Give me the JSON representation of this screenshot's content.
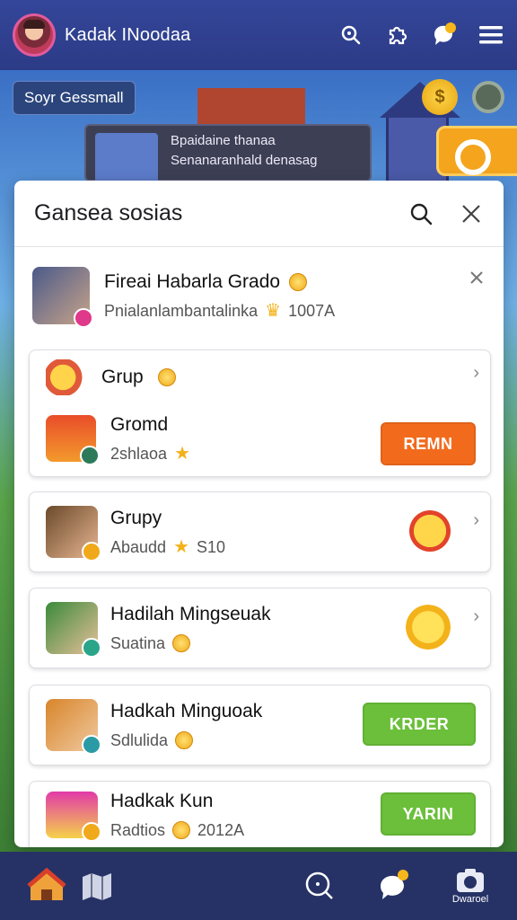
{
  "topbar": {
    "title": "Kadak INoodaa",
    "icons": [
      "search-icon",
      "puzzle-icon",
      "notification-icon",
      "menu-icon"
    ]
  },
  "scene": {
    "chip_label": "Soyr Gessmall",
    "post_line1": "Bpaidaine thanaa",
    "post_line2": "Senanaranhald denasag"
  },
  "modal": {
    "title": "Gansea sosias",
    "featured": {
      "title": "Fireai Habarla Grado",
      "subtitle": "Pnialanlambantalinka",
      "value": "1007A"
    },
    "cards": [
      {
        "group_title": "Grup",
        "title": "Gromd",
        "subtitle": "2shlaoa",
        "button": "REMN",
        "button_color": "#f26b1d"
      },
      {
        "title": "Grupy",
        "subtitle": "Abaudd",
        "value": "S10"
      },
      {
        "title": "Hadilah Mingseuak",
        "subtitle": "Suatina"
      },
      {
        "title": "Hadkah Minguoak",
        "subtitle": "Sdlulida",
        "button": "KRDER",
        "button_color": "#6bbf3a"
      },
      {
        "title": "Hadkak Kun",
        "subtitle": "Radtios",
        "value": "2012A",
        "button": "YARIN",
        "button_color": "#6bbf3a"
      }
    ]
  },
  "bottom_nav": {
    "items": [
      "home-icon",
      "map-icon",
      "search-icon",
      "chat-icon",
      "camera-icon"
    ],
    "camera_label": "Dwaroel"
  }
}
